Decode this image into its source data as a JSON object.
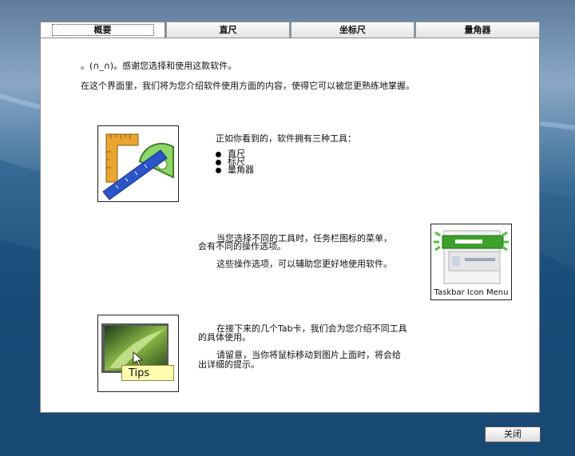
{
  "tabs": [
    {
      "label": "概要",
      "active": true
    },
    {
      "label": "直尺",
      "active": false
    },
    {
      "label": "坐标尺",
      "active": false
    },
    {
      "label": "量角器",
      "active": false
    }
  ],
  "intro": {
    "line1": "。(∩_∩)。感谢您选择和使用这款软件。",
    "line2": "在这个界面里，我们将为您介绍软件使用方面的内容，使得它可以被您更熟练地掌握。"
  },
  "tools_section": {
    "heading": "正如你看到的，软件拥有三种工具：",
    "items": [
      "直尺",
      "标尺",
      "量角器"
    ]
  },
  "menu_section": {
    "line1": "当您选择不同的工具时，任务栏图标的菜单，",
    "line2": "会有不同的操作选项。",
    "line3": "这些操作选项，可以辅助您更好地使用软件。",
    "image_caption": "Taskbar Icon Menu"
  },
  "tips_section": {
    "line1": "在接下来的几个Tab卡，我们会为您介绍不同工具",
    "line2": "的具体使用。",
    "line3": "请留意，当你将鼠标移动到图片上面时，将会给",
    "line4": "出详细的提示。",
    "image_caption": "Tips"
  },
  "buttons": {
    "close": "关闭"
  },
  "colors": {
    "accent_green": "#3ca12a",
    "ruler_yellow": "#e8a530",
    "ruler_blue": "#2a54c8"
  }
}
